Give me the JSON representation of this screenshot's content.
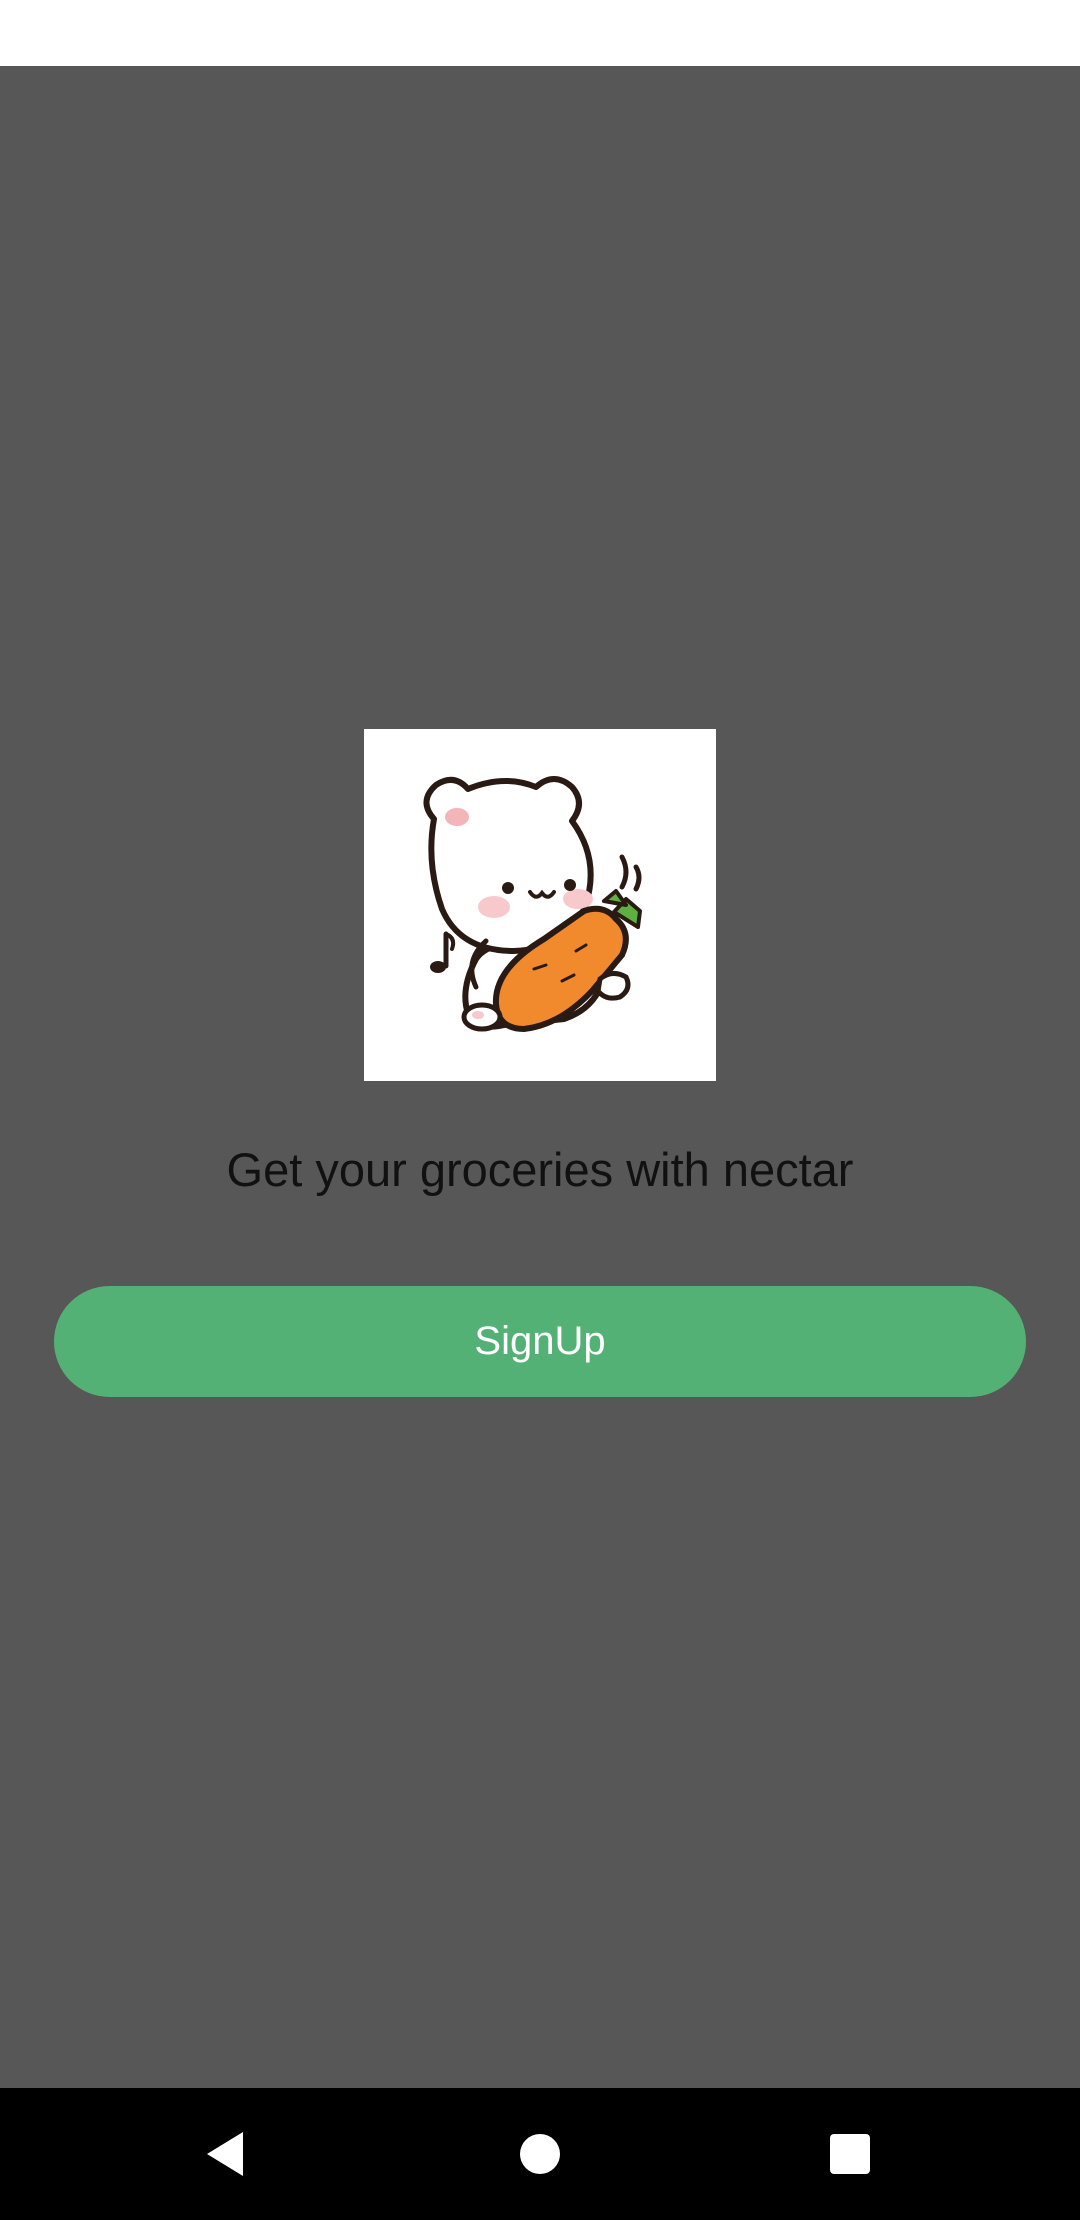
{
  "onboarding": {
    "illustration_icon": "bear-holding-carrot-icon",
    "tagline": "Get your groceries with nectar",
    "signup_label": "SignUp"
  },
  "navigation": {
    "back_icon": "triangle-back-icon",
    "home_icon": "circle-home-icon",
    "recents_icon": "square-recents-icon"
  },
  "colors": {
    "screen_background": "#575757",
    "button_green": "#53b175",
    "nav_bar": "#000000",
    "status_bar": "#ffffff"
  }
}
